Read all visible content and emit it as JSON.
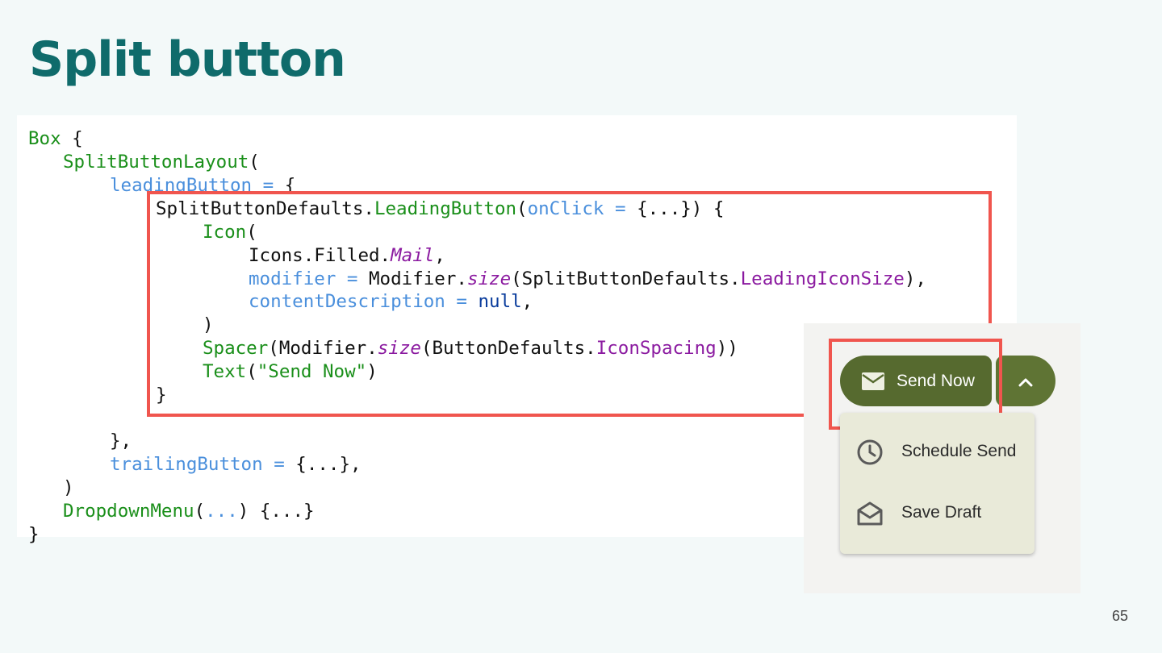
{
  "slide": {
    "title": "Split button",
    "page_number": "65"
  },
  "code": {
    "l1_a": "Box",
    "l1_b": " {",
    "l2_a": "SplitButtonLayout",
    "l2_b": "(",
    "l3_a": "leadingButton",
    "l3_b": " = ",
    "l3_c": "{",
    "l4_a": "SplitButtonDefaults.",
    "l4_b": "LeadingButton",
    "l4_c": "(",
    "l4_d": "onClick",
    "l4_e": " = ",
    "l4_f": "{...}) {",
    "l5_a": "Icon",
    "l5_b": "(",
    "l6_a": "Icons.Filled.",
    "l6_b": "Mail",
    "l6_c": ",",
    "l7_a": "modifier",
    "l7_b": " = ",
    "l7_c": "Modifier.",
    "l7_d": "size",
    "l7_e": "(SplitButtonDefaults.",
    "l7_f": "LeadingIconSize",
    "l7_g": "),",
    "l8_a": "contentDescription",
    "l8_b": " = ",
    "l8_c": "null",
    "l8_d": ",",
    "l9_a": ")",
    "l10_a": "Spacer",
    "l10_b": "(Modifier.",
    "l10_c": "size",
    "l10_d": "(ButtonDefaults.",
    "l10_e": "IconSpacing",
    "l10_f": "))",
    "l11_a": "Text",
    "l11_b": "(",
    "l11_c": "\"Send Now\"",
    "l11_d": ")",
    "l12_a": "}",
    "l13_a": "},",
    "l14_a": "trailingButton",
    "l14_b": " = ",
    "l14_c": "{...},",
    "l15_a": ")",
    "l16_a": "DropdownMenu",
    "l16_b": "(",
    "l16_c": "...",
    "l16_d": ") {...}",
    "l17_a": "}"
  },
  "demo": {
    "leading_button_label": "Send Now",
    "leading_button_icon": "mail-icon",
    "trailing_button_icon": "chevron-up-icon",
    "button_color": "#566a2f",
    "menu": {
      "items": [
        {
          "label": "Schedule Send",
          "icon": "clock-icon"
        },
        {
          "label": "Save Draft",
          "icon": "drafts-icon"
        }
      ]
    }
  },
  "colors": {
    "title": "#0f6b6b",
    "highlight": "#f0554e",
    "code_function": "#1a8f1a",
    "code_parameter": "#4a8fdc",
    "code_property": "#8b1aa0",
    "code_keyword": "#0a3c9c"
  }
}
